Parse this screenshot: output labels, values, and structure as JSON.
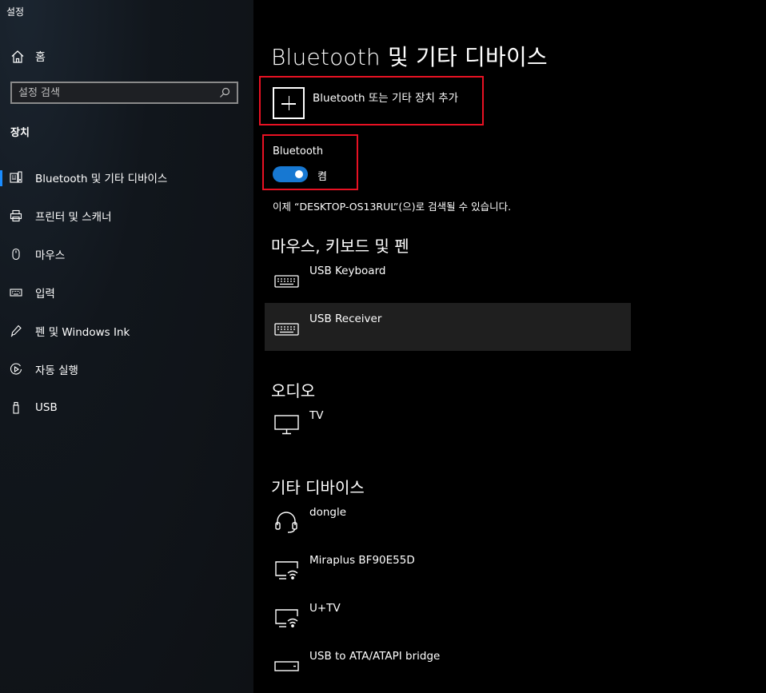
{
  "app": {
    "title": "설정"
  },
  "sidebar": {
    "home_label": "홈",
    "search_placeholder": "설정 검색",
    "section_label": "장치",
    "items": [
      {
        "label": "Bluetooth 및 기타 디바이스",
        "icon": "bluetooth-devices-icon",
        "selected": true
      },
      {
        "label": "프린터 및 스캐너",
        "icon": "printer-icon"
      },
      {
        "label": "마우스",
        "icon": "mouse-icon"
      },
      {
        "label": "입력",
        "icon": "keyboard-icon"
      },
      {
        "label": "펜 및 Windows Ink",
        "icon": "pen-icon"
      },
      {
        "label": "자동 실행",
        "icon": "autoplay-icon"
      },
      {
        "label": "USB",
        "icon": "usb-icon"
      }
    ]
  },
  "main": {
    "title": "Bluetooth 및 기타 디바이스",
    "add_device_label": "Bluetooth 또는 기타 장치 추가",
    "bluetooth_label": "Bluetooth",
    "bluetooth_state": "켬",
    "discoverable_text": "이제 “DESKTOP-OS13RUL”(으)로 검색될 수 있습니다.",
    "groups": [
      {
        "header": "마우스, 키보드 및 펜",
        "devices": [
          {
            "name": "USB Keyboard",
            "icon": "keyboard-icon"
          },
          {
            "name": "USB Receiver",
            "icon": "keyboard-icon",
            "selected": true
          }
        ]
      },
      {
        "header": "오디오",
        "devices": [
          {
            "name": "TV",
            "icon": "monitor-icon"
          }
        ]
      },
      {
        "header": "기타 디바이스",
        "devices": [
          {
            "name": "dongle",
            "icon": "headset-icon"
          },
          {
            "name": "Miraplus BF90E55D",
            "icon": "wireless-display-icon"
          },
          {
            "name": "U+TV",
            "icon": "wireless-display-icon"
          },
          {
            "name": "USB to ATA/ATAPI bridge",
            "icon": "drive-icon"
          }
        ]
      }
    ]
  },
  "colors": {
    "accent": "#1778d2",
    "highlight_box": "#e81123",
    "selected_row": "#1f1f1f"
  }
}
